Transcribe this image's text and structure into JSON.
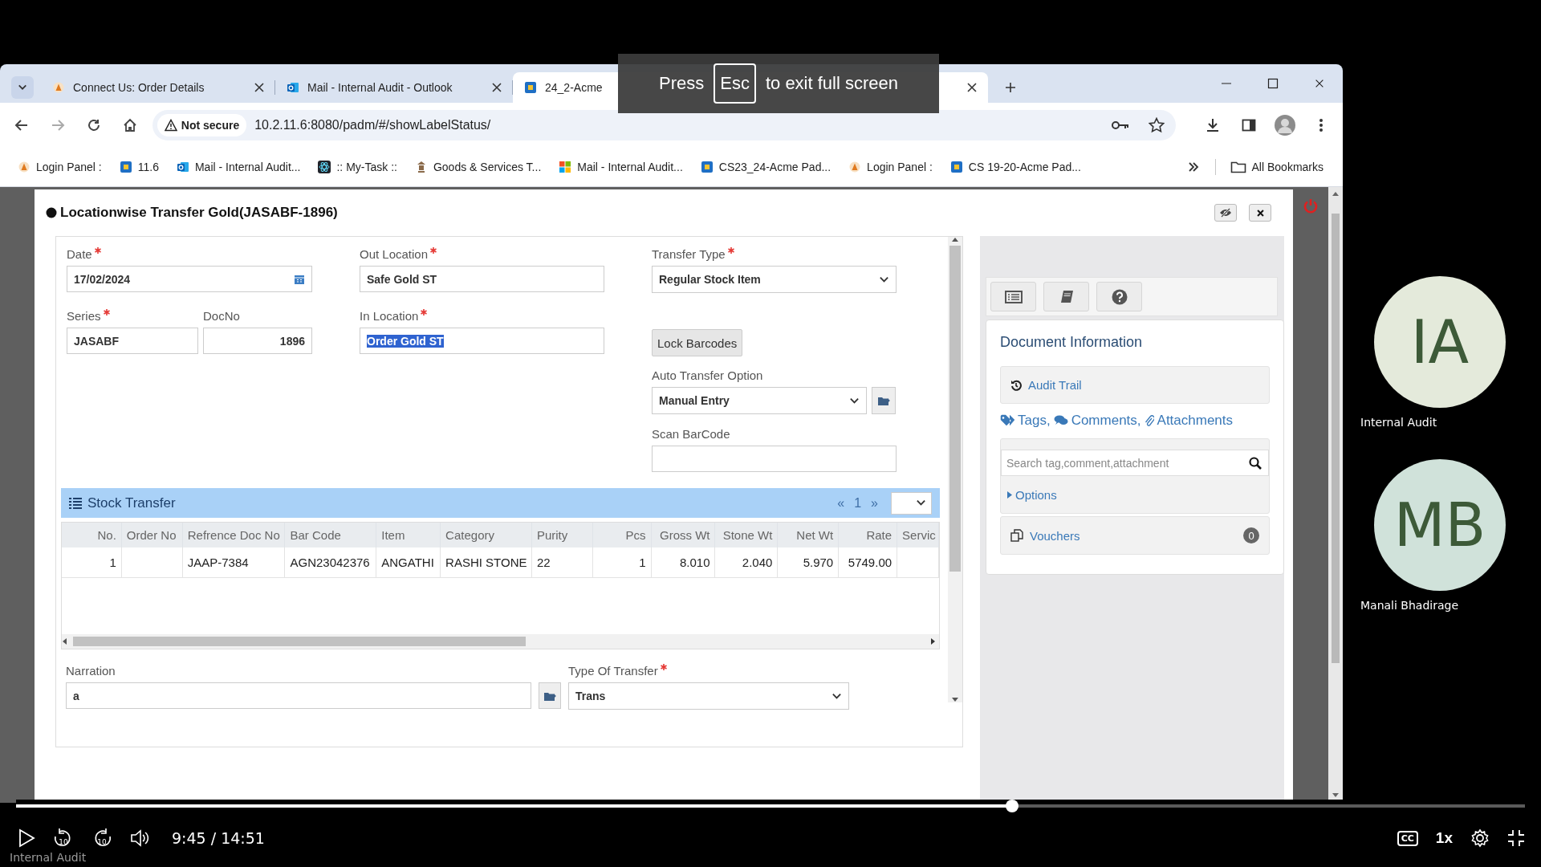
{
  "browser": {
    "tabs": [
      {
        "title": "Connect Us: Order Details",
        "kind": "sun",
        "selected": false
      },
      {
        "title": "Mail - Internal Audit - Outlook",
        "kind": "outlook",
        "selected": false
      },
      {
        "title": "24_2-Acme",
        "kind": "acme",
        "selected": true
      }
    ],
    "fullscreen_notice": {
      "before": "Press",
      "key": "Esc",
      "after": "to exit full screen"
    },
    "security": "Not secure",
    "url": "10.2.11.6:8080/padm/#/showLabelStatus/",
    "bookmarks": [
      {
        "label": "Login Panel :",
        "kind": "sun"
      },
      {
        "label": "11.6",
        "kind": "acme"
      },
      {
        "label": "Mail - Internal Audit...",
        "kind": "outlook"
      },
      {
        "label": ":: My-Task ::",
        "kind": "atom"
      },
      {
        "label": "Goods & Services T...",
        "kind": "emblem"
      },
      {
        "label": "Mail - Internal Audit...",
        "kind": "windows"
      },
      {
        "label": "CS23_24-Acme Pad...",
        "kind": "acme"
      },
      {
        "label": "Login Panel :",
        "kind": "sun"
      },
      {
        "label": "CS 19-20-Acme Pad...",
        "kind": "acme"
      }
    ],
    "all_bookmarks": "All Bookmarks"
  },
  "modal": {
    "title": "Locationwise Transfer Gold(JASABF-1896)",
    "date": {
      "label": "Date",
      "required": true,
      "value": "17/02/2024"
    },
    "series": {
      "label": "Series",
      "required": true,
      "value": "JASABF"
    },
    "doc_no": {
      "label": "DocNo",
      "required": false,
      "value": "1896"
    },
    "out_location": {
      "label": "Out Location",
      "required": true,
      "value": "Safe Gold ST"
    },
    "in_location": {
      "label": "In Location",
      "required": true,
      "value": "Order Gold ST",
      "highlighted": true
    },
    "transfer_type": {
      "label": "Transfer Type",
      "required": true,
      "value": "Regular Stock Item"
    },
    "lock_barcodes": "Lock Barcodes",
    "auto_transfer": {
      "label": "Auto Transfer Option",
      "required": false,
      "value": "Manual Entry"
    },
    "scan_barcode": {
      "label": "Scan BarCode",
      "required": false
    },
    "stock_transfer": {
      "title": "Stock Transfer",
      "pager": [
        "«",
        "1",
        "»"
      ],
      "columns": [
        "No.",
        "Order No",
        "Refrence Doc No",
        "Bar Code",
        "Item",
        "Category",
        "Purity",
        "Pcs",
        "Gross Wt",
        "Stone Wt",
        "Net Wt",
        "Rate",
        "Servic"
      ],
      "rows": [
        {
          "cells": [
            "1",
            null,
            "JAAP-7384",
            "AGN23042376",
            "ANGATHI",
            "RASHI STONE",
            "22",
            "1",
            "8.010",
            "2.040",
            "5.970",
            "5749.00",
            null
          ]
        }
      ]
    },
    "narration": {
      "label": "Narration",
      "required": false,
      "value": "a"
    },
    "type_of_transfer": {
      "label": "Type Of Transfer",
      "required": true,
      "value": "Trans"
    }
  },
  "document_info": {
    "title": "Document Information",
    "audit_trail": "Audit Trail",
    "links": [
      "Tags,",
      "Comments,",
      "Attachments"
    ],
    "search_placeholder": "Search tag,comment,attachment",
    "options": "Options",
    "vouchers": "Vouchers",
    "voucher_count": "0"
  },
  "participants": [
    {
      "initials": "IA",
      "name": "Internal Audit",
      "color": "#e4eadb"
    },
    {
      "initials": "MB",
      "name": "Manali Bhadirage",
      "color": "#d0e2da"
    }
  ],
  "player": {
    "level": 0.66,
    "rewind": "10",
    "forward": "10",
    "time": "9:45 / 14:51",
    "captions": "CC",
    "speed": "1x",
    "caption": "Internal Audit"
  }
}
